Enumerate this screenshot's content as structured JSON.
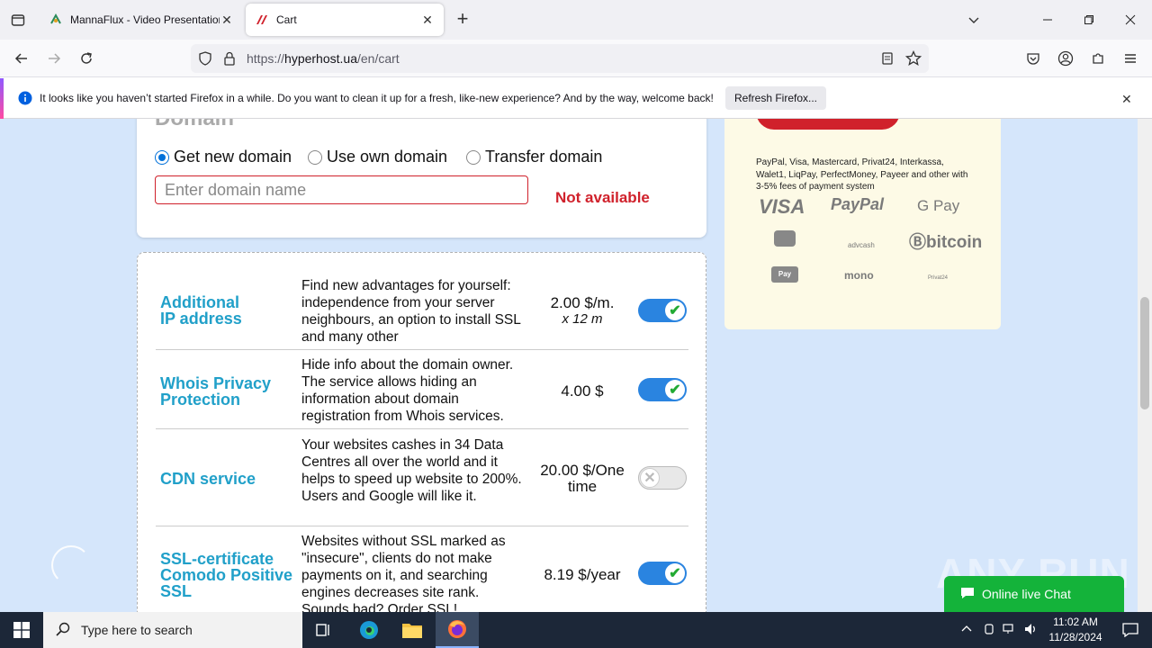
{
  "browser": {
    "tabs": [
      {
        "title": "MannaFlux - Video Presentation",
        "active": false
      },
      {
        "title": "Cart",
        "active": true
      }
    ],
    "url_prefix": "https://",
    "url_host": "hyperhost.ua",
    "url_path": "/en/cart",
    "notification": {
      "message": "It looks like you haven’t started Firefox in a while. Do you want to clean it up for a fresh, like-new experience? And by the way, welcome back!",
      "button": "Refresh Firefox..."
    }
  },
  "domain": {
    "heading": "Domain",
    "options": [
      "Get new domain",
      "Use own domain",
      "Transfer domain"
    ],
    "selected": 0,
    "input_placeholder": "Enter domain name",
    "status": "Not available"
  },
  "services": [
    {
      "name": "Additional IP address",
      "description": "Find new advantages for yourself: independence from your server neighbours, an option to install SSL and many other",
      "price": "2.00 $/m.",
      "price_note": "x 12 m",
      "enabled": true
    },
    {
      "name": "Whois Privacy Protection",
      "description": "Hide info about the domain owner. The service allows hiding an information about domain registration from Whois services.",
      "price": "4.00 $",
      "price_note": "",
      "enabled": true
    },
    {
      "name": "CDN service",
      "description": "Your websites cashes in 34 Data Centres all over the world and it helps to speed up website to 200%. Users and Google will like it.",
      "price": "20.00 $/One time",
      "price_note": "",
      "enabled": false
    },
    {
      "name": "SSL-certificate Comodo Positive SSL",
      "description": "Websites without SSL marked as \"insecure\", clients do not make payments on it, and searching engines decreases site rank. Sounds bad? Order SSL!",
      "price": "8.19 $/year",
      "price_note": "",
      "enabled": true
    }
  ],
  "payment": {
    "note": "PayPal, Visa, Mastercard, Privat24, Interkassa, Walet1, LiqPay, PerfectMoney, Payeer and other with 3-5% fees of payment system",
    "logos": [
      "VISA",
      "PayPal",
      "G Pay",
      "advcash",
      "bitcoin",
      "Pay",
      "mono",
      "Privat24"
    ]
  },
  "chat": {
    "label": "Online live Chat"
  },
  "watermark": "ANY RUN",
  "taskbar": {
    "search_placeholder": "Type here to search",
    "time": "11:02 AM",
    "date": "11/28/2024"
  },
  "colors": {
    "accent_red": "#d0212b",
    "link_blue": "#21a0c9",
    "toggle_blue": "#2a84e0",
    "chat_green": "#14b33a",
    "page_bg": "#d5e6fb"
  }
}
